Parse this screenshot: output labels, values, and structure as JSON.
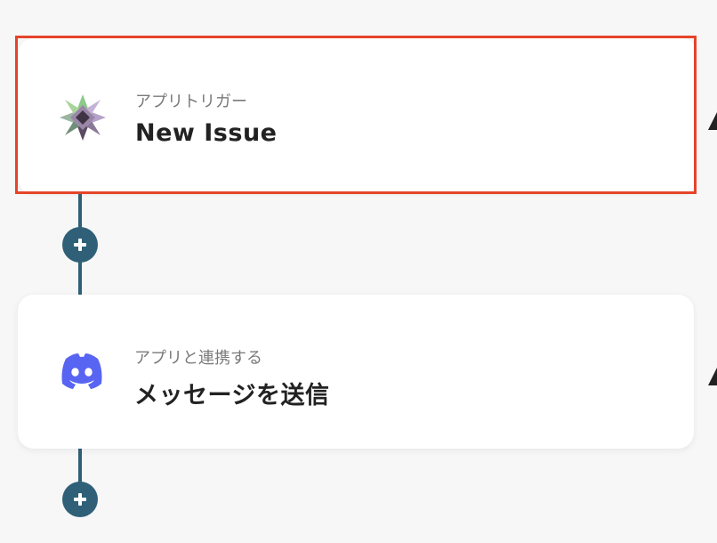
{
  "flow": {
    "steps": [
      {
        "subtitle": "アプリトリガー",
        "title": "New Issue",
        "icon": "app-star-logo-icon",
        "highlighted": true
      },
      {
        "subtitle": "アプリと連携する",
        "title": "メッセージを送信",
        "icon": "discord-logo-icon",
        "highlighted": false
      }
    ],
    "add_buttons": 2
  },
  "colors": {
    "connector": "#2f6078",
    "highlight": "#e5442b",
    "discord": "#5865f2",
    "background": "#f7f7f7"
  }
}
